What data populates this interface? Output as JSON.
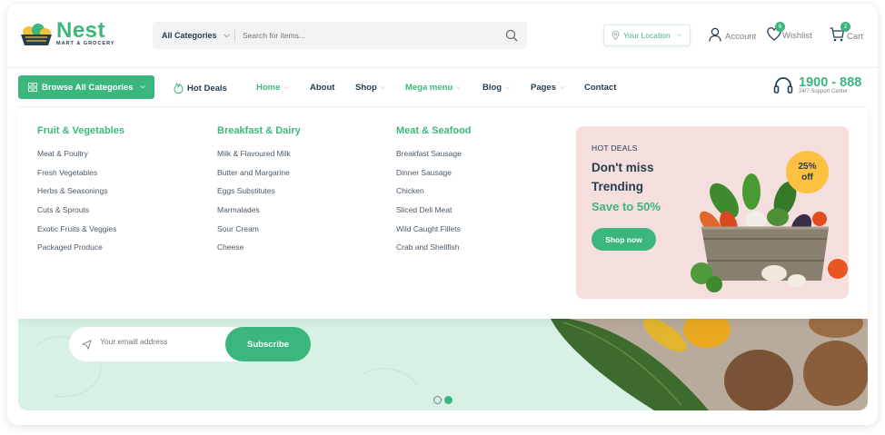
{
  "brand": {
    "name": "Nest",
    "tagline": "MART & GROCERY"
  },
  "search": {
    "category": "All Categories",
    "placeholder": "Search for items..."
  },
  "header": {
    "location": "Your Location",
    "account_label": "Account",
    "wishlist_label": "Wishlist",
    "wishlist_count": "6",
    "cart_label": "Cart",
    "cart_count": "2"
  },
  "nav": {
    "browse_label": "Browse All Categories",
    "hot_deals": "Hot Deals",
    "items": [
      {
        "label": "Home"
      },
      {
        "label": "About"
      },
      {
        "label": "Shop"
      },
      {
        "label": "Mega menu"
      },
      {
        "label": "Blog"
      },
      {
        "label": "Pages"
      },
      {
        "label": "Contact"
      }
    ],
    "support_number": "1900 - 888",
    "support_text": "24/7 Support Center"
  },
  "mega_menu": {
    "columns": [
      {
        "title": "Fruit & Vegetables",
        "items": [
          "Meat & Poultry",
          "Fresh Vegetables",
          "Herbs & Seasonings",
          "Cuts & Sprouts",
          "Exotic Fruits & Veggies",
          "Packaged Produce"
        ]
      },
      {
        "title": "Breakfast & Dairy",
        "items": [
          "Milk & Flavoured Milk",
          "Butter and Margarine",
          "Eggs Substitutes",
          "Marmalades",
          "Sour Cream",
          "Cheese"
        ]
      },
      {
        "title": "Meat & Seafood",
        "items": [
          "Breakfast Sausage",
          "Dinner Sausage",
          "Chicken",
          "Sliced Deli Meat",
          "Wild Caught Fillets",
          "Crab and Shellfish"
        ]
      }
    ],
    "promo": {
      "label": "HOT DEALS",
      "title": "Don't miss Trending",
      "save_text": "Save to 50%",
      "button": "Shop now",
      "discount_pct": "25%",
      "discount_word": "off"
    }
  },
  "hero": {
    "email_placeholder": "Your emaill address",
    "subscribe_label": "Subscribe"
  },
  "colors": {
    "brand": "#3bb77e",
    "accent": "#fdc040",
    "text": "#253d4e",
    "promo_bg": "#f4dede",
    "hero_bg": "#d8f1e5"
  }
}
